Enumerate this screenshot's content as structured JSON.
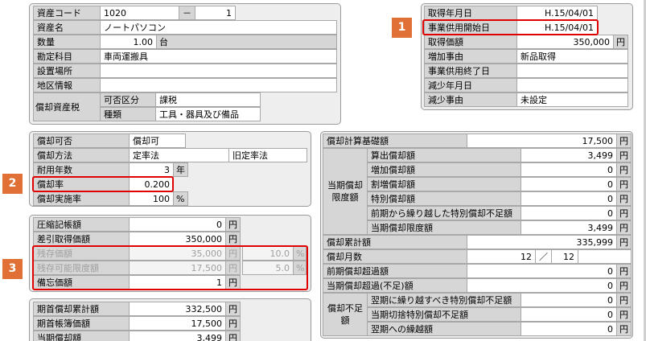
{
  "asset_info": {
    "code_label": "資産コード",
    "code_value": "1020",
    "code_sep": "－",
    "code_branch": "1",
    "name_label": "資産名",
    "name_value": "ノートパソコン",
    "qty_label": "数量",
    "qty_value": "1.00",
    "qty_unit": "台",
    "account_label": "勘定科目",
    "account_value": "車両運搬具",
    "location_label": "設置場所",
    "location_value": "",
    "region_label": "地区情報",
    "region_value": "",
    "tax_label": "償却資産税",
    "tax_class_label": "可否区分",
    "tax_class_value": "課税",
    "tax_kind_label": "種類",
    "tax_kind_value": "工具・器具及び備品"
  },
  "dates": {
    "acq_date_label": "取得年月日",
    "acq_date_value": "H.15/04/01",
    "start_label": "事業供用開始日",
    "start_value": "H.15/04/01",
    "acq_price_label": "取得価額",
    "acq_price_value": "350,000",
    "acq_price_unit": "円",
    "increase_label": "増加事由",
    "increase_value": "新品取得",
    "end_label": "事業供用終了日",
    "end_value": "",
    "decrease_date_label": "減少年月日",
    "decrease_date_value": "",
    "decrease_reason_label": "減少事由",
    "decrease_reason_value": "未設定"
  },
  "depreciation": {
    "allow_label": "償却可否",
    "allow_value": "償却可",
    "method_label": "償却方法",
    "method_value": "定率法",
    "old_method_value": "旧定率法",
    "life_label": "耐用年数",
    "life_value": "3",
    "life_unit": "年",
    "rate_label": "償却率",
    "rate_value": "0.200",
    "exec_label": "償却実施率",
    "exec_value": "100",
    "exec_unit": "%"
  },
  "book": {
    "compress_label": "圧縮記帳額",
    "compress_value": "0",
    "compress_unit": "円",
    "net_acq_label": "差引取得価額",
    "net_acq_value": "350,000",
    "net_acq_unit": "円",
    "residual_label": "残存価額",
    "residual_value": "35,000",
    "residual_unit": "円",
    "residual_pct": "10.0",
    "residual_pct_unit": "%",
    "limit_label": "残存可能限度額",
    "limit_value": "17,500",
    "limit_unit": "円",
    "limit_pct": "5.0",
    "limit_pct_unit": "%",
    "memo_label": "備忘価額",
    "memo_value": "1",
    "memo_unit": "円"
  },
  "opening": {
    "accum_label": "期首償却累計額",
    "accum_value": "332,500",
    "accum_unit": "円",
    "book_label": "期首帳簿価額",
    "book_value": "17,500",
    "book_unit": "円",
    "dep_label": "当期償却額",
    "dep_value": "3,499",
    "dep_unit": "円"
  },
  "calc": {
    "base_label": "償却計算基礎額",
    "base_value": "17,500",
    "unit": "円",
    "group_label": "当期償却限度額",
    "items": [
      {
        "label": "算出償却額",
        "value": "3,499"
      },
      {
        "label": "増加償却額",
        "value": "0"
      },
      {
        "label": "割増償却額",
        "value": "0"
      },
      {
        "label": "特別償却額",
        "value": "0"
      },
      {
        "label": "前期から繰り越した特別償却不足額",
        "value": "0"
      },
      {
        "label": "当期償却限度額",
        "value": "3,499"
      }
    ],
    "accum_label": "償却累計額",
    "accum_value": "335,999",
    "months_label": "償却月数",
    "months_value": "12",
    "months_sep": "／",
    "months_total": "12",
    "prev_excess_label": "前期償却超過額",
    "prev_excess_value": "0",
    "curr_excess_label": "当期償却超過(不足)額",
    "curr_excess_value": "0",
    "short_group_label": "償却不足額",
    "short_items": [
      {
        "label": "翌期に繰り越すべき特別償却不足額",
        "value": "0"
      },
      {
        "label": "当期切捨特別償却不足額",
        "value": "0"
      },
      {
        "label": "翌期への繰越額",
        "value": "0"
      }
    ]
  },
  "badges": {
    "b1": "1",
    "b2": "2",
    "b3": "3"
  }
}
